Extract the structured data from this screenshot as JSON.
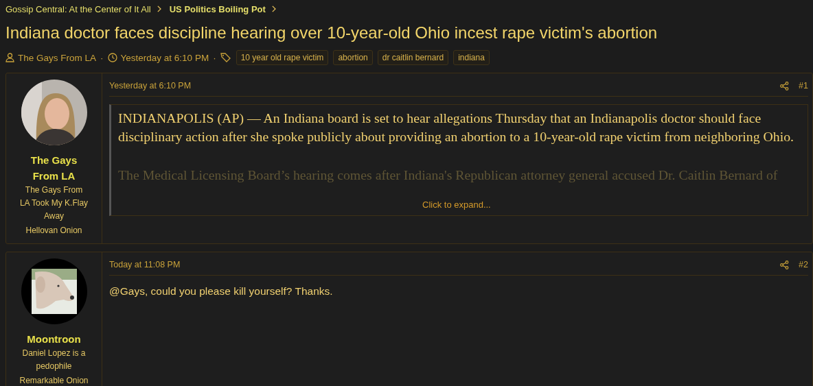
{
  "breadcrumbs": [
    {
      "label": "Gossip Central: At the Center of It All",
      "current": false
    },
    {
      "label": "US Politics Boiling Pot",
      "current": true
    }
  ],
  "thread": {
    "title": "Indiana doctor faces discipline hearing over 10-year-old Ohio incest rape victim's abortion",
    "author": "The Gays From LA",
    "separator": "·",
    "date": "Yesterday at 6:10 PM",
    "tags": [
      "10 year old rape victim",
      "abortion",
      "dr caitlin bernard",
      "indiana"
    ]
  },
  "posts": [
    {
      "username": "The Gays From LA",
      "custom_title": "The Gays From LA Took My K.Flay Away",
      "rank": "Hellovan Onion",
      "date": "Yesterday at 6:10 PM",
      "number": "#1",
      "quote": {
        "paragraphs": [
          "INDIANAPOLIS (AP) — An Indiana board is set to hear allegations Thursday that an Indianapolis doctor should face disciplinary action after she spoke publicly about providing an abortion to a 10-year-old rape victim from neighboring Ohio.",
          "The Medical Licensing Board’s hearing comes after Indiana's Republican attorney general accused Dr. Caitlin Bernard of"
        ],
        "expand_link": "Click to expand..."
      }
    },
    {
      "username": "Moontroon",
      "custom_title": "Daniel Lopez is a pedophile",
      "rank": "Remarkable Onion",
      "date": "Today at 11:08 PM",
      "number": "#2",
      "body": "@Gays, could you please kill yourself? Thanks."
    }
  ]
}
